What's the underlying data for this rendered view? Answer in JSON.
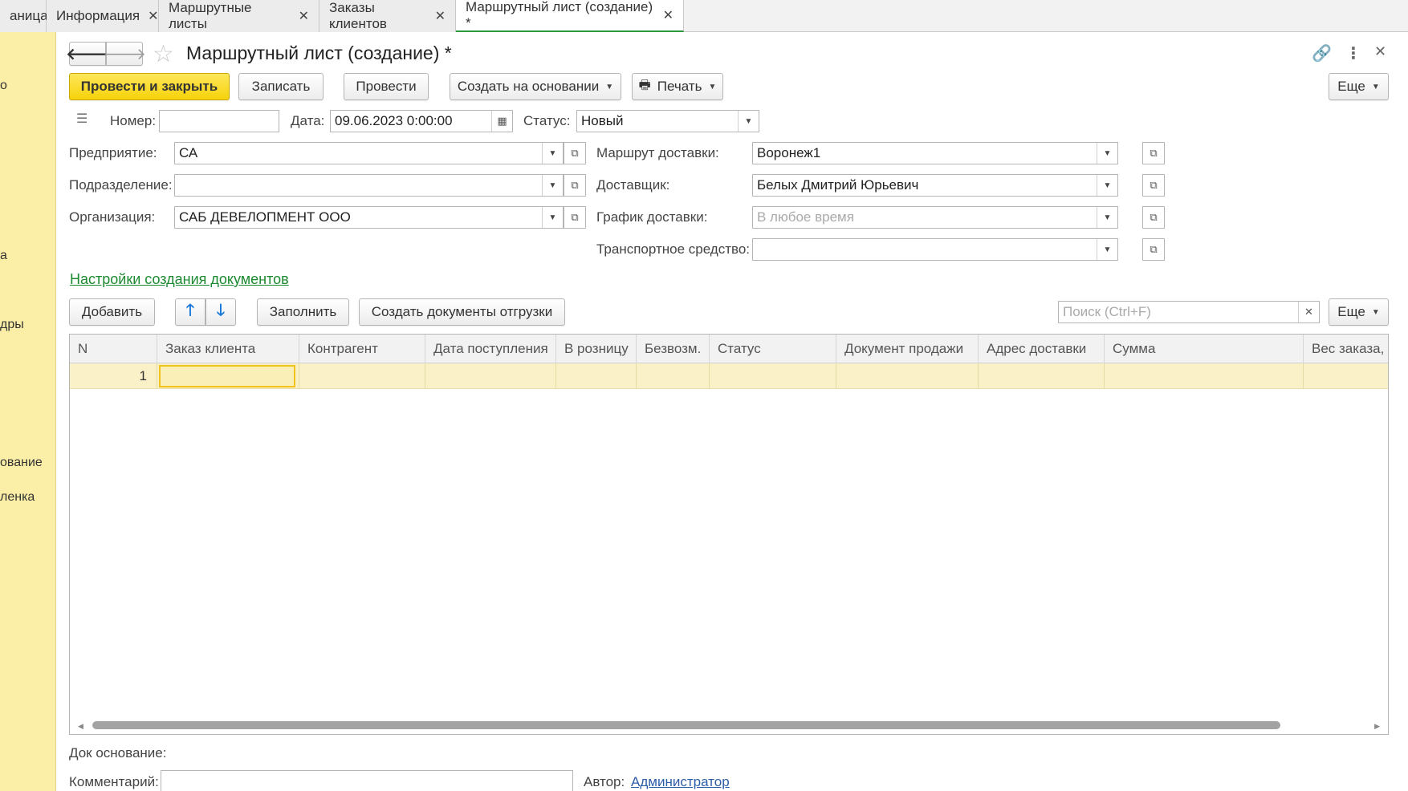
{
  "tabs": [
    {
      "label": "аница",
      "closable": false,
      "active": false
    },
    {
      "label": "Информация",
      "closable": true,
      "active": false
    },
    {
      "label": "Маршрутные листы",
      "closable": true,
      "active": false
    },
    {
      "label": "Заказы клиентов",
      "closable": true,
      "active": false
    },
    {
      "label": "Маршрутный лист (создание) *",
      "closable": true,
      "active": true
    }
  ],
  "left_panel": {
    "items": [
      "о",
      "а",
      "дры",
      "ование",
      "ленка"
    ]
  },
  "header": {
    "title": "Маршрутный лист (создание) *",
    "back_icon": "arrow-left-icon",
    "forward_icon": "arrow-right-icon",
    "favorite_icon": "star-icon",
    "link_icon": "link-icon",
    "more_icon": "kebab-icon",
    "close_icon": "close-icon"
  },
  "toolbar": {
    "post_and_close": "Провести и закрыть",
    "save": "Записать",
    "post": "Провести",
    "create_based_on": "Создать на основании",
    "print": "Печать",
    "more": "Еще"
  },
  "fields": {
    "number_label": "Номер:",
    "number_value": "",
    "date_label": "Дата:",
    "date_value": "09.06.2023  0:00:00",
    "status_label": "Статус:",
    "status_value": "Новый",
    "enterprise_label": "Предприятие:",
    "enterprise_value": "СА",
    "division_label": "Подразделение:",
    "division_value": "",
    "organization_label": "Организация:",
    "organization_value": "САБ ДЕВЕЛОПМЕНТ ООО",
    "route_label": "Маршрут доставки:",
    "route_value": "Воронеж1",
    "courier_label": "Доставщик:",
    "courier_value": "Белых Дмитрий Юрьевич",
    "schedule_label": "График доставки:",
    "schedule_placeholder": "В любое время",
    "vehicle_label": "Транспортное средство:",
    "vehicle_value": ""
  },
  "settings_link": "Настройки создания документов",
  "table_toolbar": {
    "add": "Добавить",
    "fill": "Заполнить",
    "create_shipping_docs": "Создать документы отгрузки",
    "search_placeholder": "Поиск (Ctrl+F)",
    "more": "Еще"
  },
  "table": {
    "columns": [
      "N",
      "Заказ клиента",
      "Контрагент",
      "Дата поступления",
      "В розницу",
      "Безвозм.",
      "Статус",
      "Документ продажи",
      "Адрес доставки",
      "Сумма",
      "Вес заказа,"
    ],
    "rows": [
      {
        "n": "1"
      }
    ]
  },
  "footer": {
    "base_doc_label": "Док основание:",
    "comment_label": "Комментарий:",
    "comment_value": "",
    "author_label": "Автор:",
    "author_value": "Администратор"
  },
  "colors": {
    "accent_green": "#1c8a30",
    "primary_button": "#f5d20a",
    "left_panel": "#fbeea6",
    "selected_row": "#fbf1c8"
  }
}
